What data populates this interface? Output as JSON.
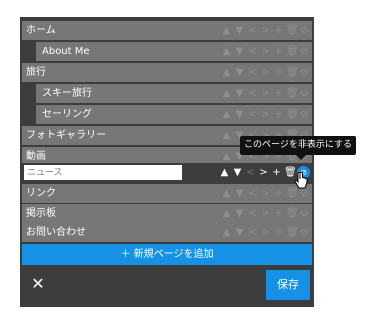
{
  "menu": {
    "items": [
      {
        "label": "ホーム",
        "level": 0
      },
      {
        "label": "About Me",
        "level": 1
      },
      {
        "label": "旅行",
        "level": 0
      },
      {
        "label": "スキー旅行",
        "level": 1
      },
      {
        "label": "セーリング",
        "level": 1
      },
      {
        "label": "フォトギャラリー",
        "level": 0
      },
      {
        "label": "動画",
        "level": 0
      },
      {
        "label": "",
        "level": 0,
        "editing": true,
        "placeholder": "ニュース"
      },
      {
        "label": "リンク",
        "level": 0
      },
      {
        "label": "掲示板",
        "level": 0
      },
      {
        "label": "お問い合わせ",
        "level": 0
      }
    ]
  },
  "controls": {
    "up": "▲",
    "down": "▼",
    "left": "<",
    "right": ">",
    "add": "+",
    "delete": "trash-icon",
    "hide": "eye-off-icon"
  },
  "tooltip": {
    "text": "このページを非表示にする"
  },
  "footer": {
    "add_label": "＋ 新規ページを追加",
    "close_label": "✕",
    "save_label": "保存"
  },
  "colors": {
    "accent": "#1592e6",
    "row": "#777777",
    "panel": "#3d3d3d"
  }
}
